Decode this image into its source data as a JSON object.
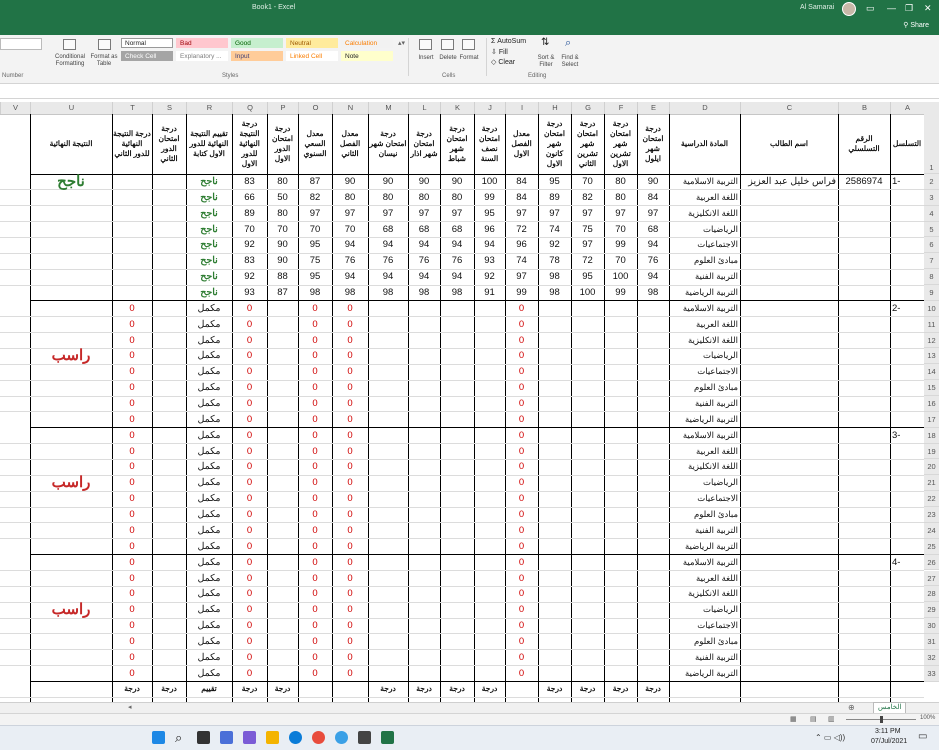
{
  "window": {
    "title": "Book1 - Excel",
    "user": "Al Samarai",
    "share": "Share"
  },
  "ribbon": {
    "styles": [
      {
        "label": "Normal",
        "bg": "#ffffff",
        "fg": "#222222"
      },
      {
        "label": "Bad",
        "bg": "#ffc7ce",
        "fg": "#9c0006"
      },
      {
        "label": "Good",
        "bg": "#c6efce",
        "fg": "#006100"
      },
      {
        "label": "Neutral",
        "bg": "#ffeb9c",
        "fg": "#9c5700"
      },
      {
        "label": "Calculation",
        "bg": "#f2f2f2",
        "fg": "#fa7d00"
      },
      {
        "label": "Check Cell",
        "bg": "#a5a5a5",
        "fg": "#ffffff"
      },
      {
        "label": "Explanatory ...",
        "bg": "#ffffff",
        "fg": "#7f7f7f"
      },
      {
        "label": "Input",
        "bg": "#ffcc99",
        "fg": "#3f3f76"
      },
      {
        "label": "Linked Cell",
        "bg": "#ffffff",
        "fg": "#fa7d00"
      },
      {
        "label": "Note",
        "bg": "#ffffcc",
        "fg": "#222222"
      }
    ],
    "conditional": "Conditional Formatting",
    "format_table": "Format as Table",
    "insert": "Insert",
    "delete": "Delete",
    "format": "Format",
    "autosum": "AutoSum",
    "fill": "Fill",
    "clear": "Clear",
    "sort_filter": "Sort & Filter",
    "find_select": "Find & Select",
    "group_styles": "Styles",
    "group_cells": "Cells",
    "group_editing": "Editing",
    "group_number": "Number"
  },
  "columns": [
    "V",
    "U",
    "T",
    "S",
    "R",
    "Q",
    "P",
    "O",
    "N",
    "M",
    "L",
    "K",
    "J",
    "I",
    "H",
    "G",
    "F",
    "E",
    "D",
    "C",
    "B",
    "A"
  ],
  "headers": {
    "A": "التسلسل",
    "B": "الرقم التسلسلي",
    "C": "اسم الطالب",
    "D": "المادة الدراسية",
    "E": "درجة امتحان شهر ايلول",
    "F": "درجة امتحان شهر تشرين الاول",
    "G": "درجة امتحان شهر تشرين الثاني",
    "H": "درجة امتحان شهر كانون الاول",
    "I": "معدل الفصل الاول",
    "J": "درجة امتحان نصف السنة",
    "K": "درجة امتحان شهر شباط",
    "L": "درجة امتحان شهر اذار",
    "M": "درجة امتحان شهر نيسان",
    "N": "معدل الفصل الثاني",
    "O": "معدل السعي السنوي",
    "P": "درجة امتحان الدور الاول",
    "Q": "درجة النتيجة النهائية للدور الاول",
    "R": "تقييم النتيجة النهائية للدور الاول كتابة",
    "S": "درجة امتحان الدور الثاني",
    "T": "درجة النتيجة النهائية للدور الثاني",
    "U": "النتيجة النهائية"
  },
  "subjects": [
    "التربية الاسلامية",
    "اللغة العربية",
    "اللغة الانكليزية",
    "الرياضيات",
    "الاجتماعيات",
    "مبادئ العلوم",
    "التربية الفنية",
    "التربية الرياضية"
  ],
  "students": [
    {
      "seq": "1-",
      "serial": "2586974",
      "name": "فراس خليل عبد العزيز",
      "final": "ناجح",
      "final_color": "#2e7d32",
      "rows": [
        {
          "E": "90",
          "F": "80",
          "G": "70",
          "H": "95",
          "I": "84",
          "J": "100",
          "K": "90",
          "L": "90",
          "M": "90",
          "N": "90",
          "O": "87",
          "P": "80",
          "Q": "83",
          "R": "ناجح",
          "S": "",
          "T": ""
        },
        {
          "E": "84",
          "F": "80",
          "G": "82",
          "H": "89",
          "I": "84",
          "J": "99",
          "K": "80",
          "L": "80",
          "M": "80",
          "N": "80",
          "O": "82",
          "P": "50",
          "Q": "66",
          "R": "ناجح",
          "S": "",
          "T": ""
        },
        {
          "E": "97",
          "F": "97",
          "G": "97",
          "H": "97",
          "I": "97",
          "J": "95",
          "K": "97",
          "L": "97",
          "M": "97",
          "N": "97",
          "O": "97",
          "P": "80",
          "Q": "89",
          "R": "ناجح",
          "S": "",
          "T": ""
        },
        {
          "E": "68",
          "F": "70",
          "G": "75",
          "H": "74",
          "I": "72",
          "J": "96",
          "K": "68",
          "L": "68",
          "M": "68",
          "N": "70",
          "O": "70",
          "P": "70",
          "Q": "70",
          "R": "ناجح",
          "S": "",
          "T": ""
        },
        {
          "E": "94",
          "F": "99",
          "G": "97",
          "H": "92",
          "I": "96",
          "J": "94",
          "K": "94",
          "L": "94",
          "M": "94",
          "N": "94",
          "O": "95",
          "P": "90",
          "Q": "92",
          "R": "ناجح",
          "S": "",
          "T": ""
        },
        {
          "E": "76",
          "F": "70",
          "G": "72",
          "H": "78",
          "I": "74",
          "J": "93",
          "K": "76",
          "L": "76",
          "M": "76",
          "N": "76",
          "O": "75",
          "P": "90",
          "Q": "83",
          "R": "ناجح",
          "S": "",
          "T": ""
        },
        {
          "E": "94",
          "F": "100",
          "G": "95",
          "H": "98",
          "I": "97",
          "J": "92",
          "K": "94",
          "L": "94",
          "M": "94",
          "N": "94",
          "O": "95",
          "P": "88",
          "Q": "92",
          "R": "ناجح",
          "S": "",
          "T": ""
        },
        {
          "E": "98",
          "F": "99",
          "G": "100",
          "H": "98",
          "I": "99",
          "J": "91",
          "K": "98",
          "L": "98",
          "M": "98",
          "N": "98",
          "O": "98",
          "P": "87",
          "Q": "93",
          "R": "ناجح",
          "S": "",
          "T": ""
        }
      ]
    },
    {
      "seq": "2-",
      "serial": "",
      "name": "",
      "final": "راسب",
      "final_color": "#c62828",
      "rows": [
        {
          "E": "",
          "F": "",
          "G": "",
          "H": "",
          "I": "0",
          "J": "",
          "K": "",
          "L": "",
          "M": "",
          "N": "0",
          "O": "0",
          "P": "",
          "Q": "0",
          "R": "مكمل",
          "S": "",
          "T": "0"
        },
        {
          "E": "",
          "F": "",
          "G": "",
          "H": "",
          "I": "0",
          "J": "",
          "K": "",
          "L": "",
          "M": "",
          "N": "0",
          "O": "0",
          "P": "",
          "Q": "0",
          "R": "مكمل",
          "S": "",
          "T": "0"
        },
        {
          "E": "",
          "F": "",
          "G": "",
          "H": "",
          "I": "0",
          "J": "",
          "K": "",
          "L": "",
          "M": "",
          "N": "0",
          "O": "0",
          "P": "",
          "Q": "0",
          "R": "مكمل",
          "S": "",
          "T": "0"
        },
        {
          "E": "",
          "F": "",
          "G": "",
          "H": "",
          "I": "0",
          "J": "",
          "K": "",
          "L": "",
          "M": "",
          "N": "0",
          "O": "0",
          "P": "",
          "Q": "0",
          "R": "مكمل",
          "S": "",
          "T": "0"
        },
        {
          "E": "",
          "F": "",
          "G": "",
          "H": "",
          "I": "0",
          "J": "",
          "K": "",
          "L": "",
          "M": "",
          "N": "0",
          "O": "0",
          "P": "",
          "Q": "0",
          "R": "مكمل",
          "S": "",
          "T": "0"
        },
        {
          "E": "",
          "F": "",
          "G": "",
          "H": "",
          "I": "0",
          "J": "",
          "K": "",
          "L": "",
          "M": "",
          "N": "0",
          "O": "0",
          "P": "",
          "Q": "0",
          "R": "مكمل",
          "S": "",
          "T": "0"
        },
        {
          "E": "",
          "F": "",
          "G": "",
          "H": "",
          "I": "0",
          "J": "",
          "K": "",
          "L": "",
          "M": "",
          "N": "0",
          "O": "0",
          "P": "",
          "Q": "0",
          "R": "مكمل",
          "S": "",
          "T": "0"
        },
        {
          "E": "",
          "F": "",
          "G": "",
          "H": "",
          "I": "0",
          "J": "",
          "K": "",
          "L": "",
          "M": "",
          "N": "0",
          "O": "0",
          "P": "",
          "Q": "0",
          "R": "مكمل",
          "S": "",
          "T": "0"
        }
      ]
    },
    {
      "seq": "3-",
      "serial": "",
      "name": "",
      "final": "راسب",
      "final_color": "#c62828",
      "rows": [
        {
          "E": "",
          "F": "",
          "G": "",
          "H": "",
          "I": "0",
          "J": "",
          "K": "",
          "L": "",
          "M": "",
          "N": "0",
          "O": "0",
          "P": "",
          "Q": "0",
          "R": "مكمل",
          "S": "",
          "T": "0"
        },
        {
          "E": "",
          "F": "",
          "G": "",
          "H": "",
          "I": "0",
          "J": "",
          "K": "",
          "L": "",
          "M": "",
          "N": "0",
          "O": "0",
          "P": "",
          "Q": "0",
          "R": "مكمل",
          "S": "",
          "T": "0"
        },
        {
          "E": "",
          "F": "",
          "G": "",
          "H": "",
          "I": "0",
          "J": "",
          "K": "",
          "L": "",
          "M": "",
          "N": "0",
          "O": "0",
          "P": "",
          "Q": "0",
          "R": "مكمل",
          "S": "",
          "T": "0"
        },
        {
          "E": "",
          "F": "",
          "G": "",
          "H": "",
          "I": "0",
          "J": "",
          "K": "",
          "L": "",
          "M": "",
          "N": "0",
          "O": "0",
          "P": "",
          "Q": "0",
          "R": "مكمل",
          "S": "",
          "T": "0"
        },
        {
          "E": "",
          "F": "",
          "G": "",
          "H": "",
          "I": "0",
          "J": "",
          "K": "",
          "L": "",
          "M": "",
          "N": "0",
          "O": "0",
          "P": "",
          "Q": "0",
          "R": "مكمل",
          "S": "",
          "T": "0"
        },
        {
          "E": "",
          "F": "",
          "G": "",
          "H": "",
          "I": "0",
          "J": "",
          "K": "",
          "L": "",
          "M": "",
          "N": "0",
          "O": "0",
          "P": "",
          "Q": "0",
          "R": "مكمل",
          "S": "",
          "T": "0"
        },
        {
          "E": "",
          "F": "",
          "G": "",
          "H": "",
          "I": "0",
          "J": "",
          "K": "",
          "L": "",
          "M": "",
          "N": "0",
          "O": "0",
          "P": "",
          "Q": "0",
          "R": "مكمل",
          "S": "",
          "T": "0"
        },
        {
          "E": "",
          "F": "",
          "G": "",
          "H": "",
          "I": "0",
          "J": "",
          "K": "",
          "L": "",
          "M": "",
          "N": "0",
          "O": "0",
          "P": "",
          "Q": "0",
          "R": "مكمل",
          "S": "",
          "T": "0"
        }
      ]
    },
    {
      "seq": "4-",
      "serial": "",
      "name": "",
      "final": "راسب",
      "final_color": "#c62828",
      "rows": [
        {
          "E": "",
          "F": "",
          "G": "",
          "H": "",
          "I": "0",
          "J": "",
          "K": "",
          "L": "",
          "M": "",
          "N": "0",
          "O": "0",
          "P": "",
          "Q": "0",
          "R": "مكمل",
          "S": "",
          "T": "0"
        },
        {
          "E": "",
          "F": "",
          "G": "",
          "H": "",
          "I": "0",
          "J": "",
          "K": "",
          "L": "",
          "M": "",
          "N": "0",
          "O": "0",
          "P": "",
          "Q": "0",
          "R": "مكمل",
          "S": "",
          "T": "0"
        },
        {
          "E": "",
          "F": "",
          "G": "",
          "H": "",
          "I": "0",
          "J": "",
          "K": "",
          "L": "",
          "M": "",
          "N": "0",
          "O": "0",
          "P": "",
          "Q": "0",
          "R": "مكمل",
          "S": "",
          "T": "0"
        },
        {
          "E": "",
          "F": "",
          "G": "",
          "H": "",
          "I": "0",
          "J": "",
          "K": "",
          "L": "",
          "M": "",
          "N": "0",
          "O": "0",
          "P": "",
          "Q": "0",
          "R": "مكمل",
          "S": "",
          "T": "0"
        },
        {
          "E": "",
          "F": "",
          "G": "",
          "H": "",
          "I": "0",
          "J": "",
          "K": "",
          "L": "",
          "M": "",
          "N": "0",
          "O": "0",
          "P": "",
          "Q": "0",
          "R": "مكمل",
          "S": "",
          "T": "0"
        },
        {
          "E": "",
          "F": "",
          "G": "",
          "H": "",
          "I": "0",
          "J": "",
          "K": "",
          "L": "",
          "M": "",
          "N": "0",
          "O": "0",
          "P": "",
          "Q": "0",
          "R": "مكمل",
          "S": "",
          "T": "0"
        },
        {
          "E": "",
          "F": "",
          "G": "",
          "H": "",
          "I": "0",
          "J": "",
          "K": "",
          "L": "",
          "M": "",
          "N": "0",
          "O": "0",
          "P": "",
          "Q": "0",
          "R": "مكمل",
          "S": "",
          "T": "0"
        },
        {
          "E": "",
          "F": "",
          "G": "",
          "H": "",
          "I": "0",
          "J": "",
          "K": "",
          "L": "",
          "M": "",
          "N": "0",
          "O": "0",
          "P": "",
          "Q": "0",
          "R": "مكمل",
          "S": "",
          "T": "0"
        }
      ]
    }
  ],
  "partial_headers": {
    "T": "درجة",
    "S": "درجة",
    "R": "تقييم",
    "Q": "درجة",
    "P": "درجة",
    "M": "درجة",
    "L": "درجة",
    "K": "درجة",
    "J": "درجة",
    "H": "درجة",
    "G": "درجة",
    "F": "درجة",
    "E": "درجة"
  },
  "row_numbers": [
    "1",
    "2",
    "3",
    "4",
    "5",
    "6",
    "7",
    "8",
    "9",
    "10",
    "11",
    "12",
    "13",
    "14",
    "15",
    "16",
    "17",
    "18",
    "19",
    "20",
    "21",
    "22",
    "23",
    "24",
    "25",
    "26",
    "27",
    "28",
    "29",
    "30",
    "31",
    "32",
    "33"
  ],
  "sheet_tab": "الخامس",
  "status": {
    "zoom": "100%"
  },
  "taskbar": {
    "time": "3:11 PM",
    "date": "07/Jul/2021"
  }
}
